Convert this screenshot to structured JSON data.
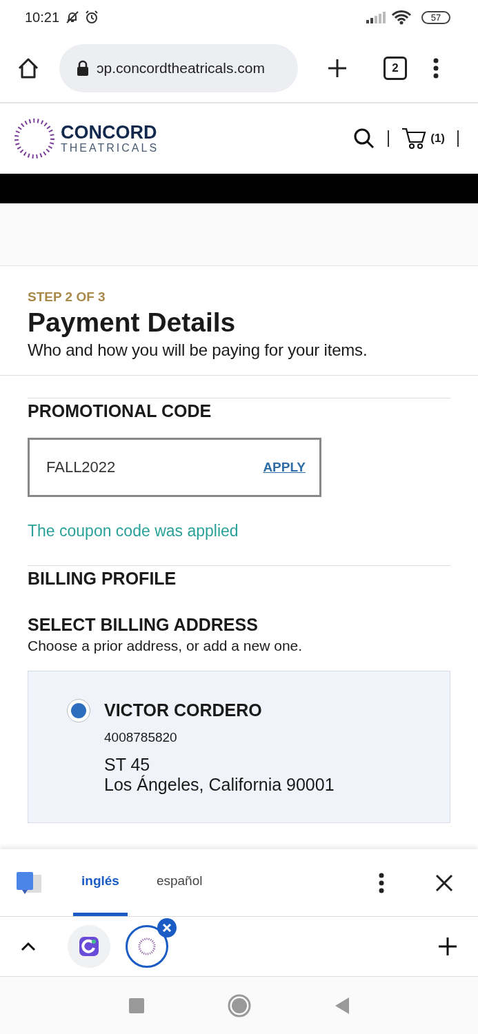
{
  "status_bar": {
    "time": "10:21",
    "battery": "57"
  },
  "browser": {
    "url": "ɔp.concordtheatricals.com",
    "tab_count": "2"
  },
  "site_header": {
    "logo_top": "CONCORD",
    "logo_bottom": "THEATRICALS",
    "cart_count": "(1)"
  },
  "checkout": {
    "step": "STEP 2 OF 3",
    "title": "Payment Details",
    "subtitle": "Who and how you will be paying for your items."
  },
  "promo": {
    "heading": "PROMOTIONAL CODE",
    "value": "FALL2022",
    "apply": "APPLY",
    "message": "The coupon code was applied"
  },
  "billing": {
    "heading": "BILLING PROFILE",
    "subheading": "SELECT BILLING ADDRESS",
    "hint": "Choose a prior address, or add a new one.",
    "addresses": [
      {
        "name": "VICTOR CORDERO",
        "phone": "4008785820",
        "line1": "ST 45",
        "line2": "Los Ángeles, California 90001",
        "selected": true
      }
    ]
  },
  "translate_bar": {
    "languages": [
      {
        "label": "inglés",
        "selected": true
      },
      {
        "label": "español",
        "selected": false
      }
    ]
  }
}
